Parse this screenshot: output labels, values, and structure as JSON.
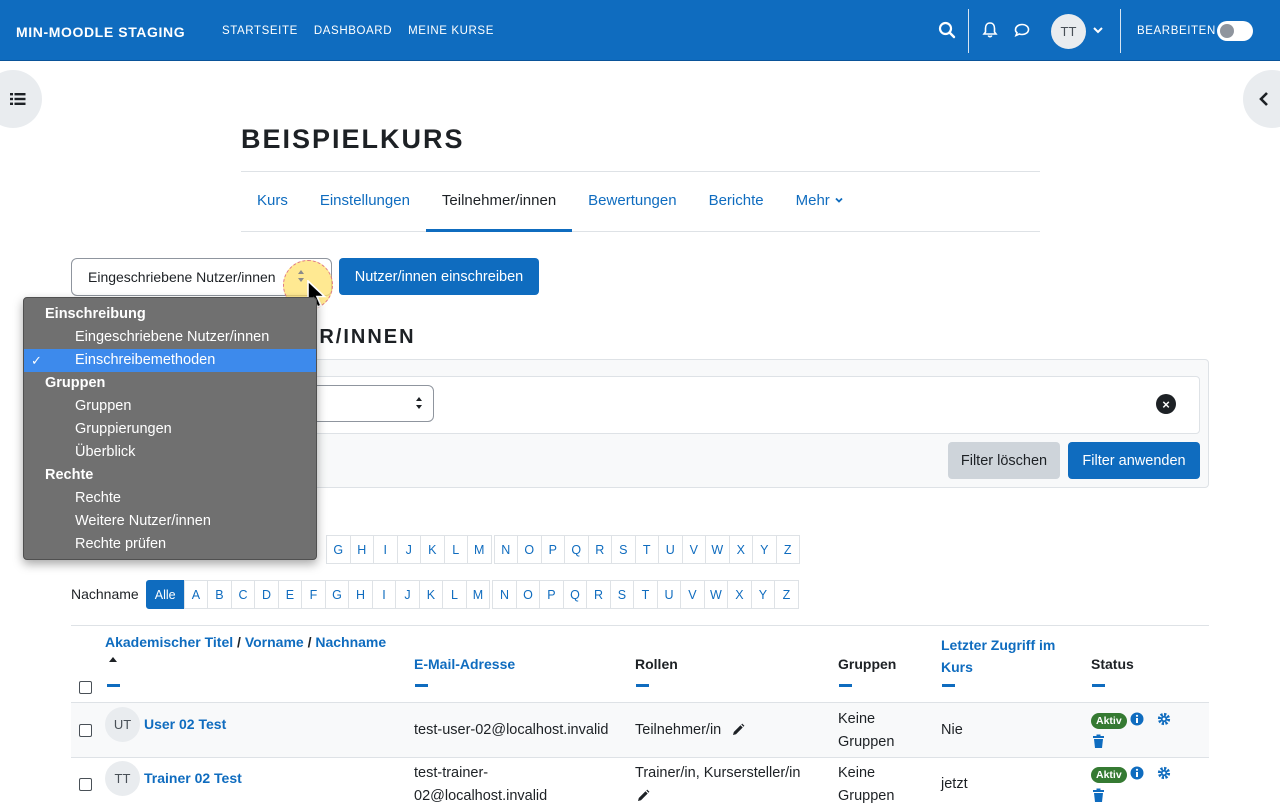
{
  "navbar": {
    "brand": "MIN-MOODLE STAGING",
    "links": [
      "STARTSEITE",
      "DASHBOARD",
      "MEINE KURSE"
    ],
    "user_initials": "TT",
    "edit_label": "BEARBEITEN"
  },
  "course": {
    "title": "BEISPIELKURS",
    "tabs": [
      {
        "label": "Kurs",
        "active": false
      },
      {
        "label": "Einstellungen",
        "active": false
      },
      {
        "label": "Teilnehmer/innen",
        "active": true
      },
      {
        "label": "Bewertungen",
        "active": false
      },
      {
        "label": "Berichte",
        "active": false
      },
      {
        "label": "Mehr",
        "active": false
      }
    ]
  },
  "toolbar": {
    "select_value": "Eingeschriebene Nutzer/innen",
    "enrol_button": "Nutzer/innen einschreiben"
  },
  "section": {
    "heading_visible_part": "ER/INNEN"
  },
  "filters": {
    "clear_button": "Filter löschen",
    "apply_button": "Filter anwenden"
  },
  "alpha": {
    "firstname_letters_visible": [
      "G",
      "H",
      "I",
      "J",
      "K",
      "L",
      "M",
      "N",
      "O",
      "P",
      "Q",
      "R",
      "S",
      "T",
      "U",
      "V",
      "W",
      "X",
      "Y",
      "Z"
    ],
    "lastname_label": "Nachname",
    "lastname_letters": [
      "Alle",
      "A",
      "B",
      "C",
      "D",
      "E",
      "F",
      "G",
      "H",
      "I",
      "J",
      "K",
      "L",
      "M",
      "N",
      "O",
      "P",
      "Q",
      "R",
      "S",
      "T",
      "U",
      "V",
      "W",
      "X",
      "Y",
      "Z"
    ]
  },
  "table": {
    "headers": {
      "name_part1": "Akademischer Titel",
      "name_part2": "Vorname",
      "name_part3": "Nachname",
      "separator": "/",
      "email": "E-Mail-Adresse",
      "roles": "Rollen",
      "groups": "Gruppen",
      "last_access": "Letzter Zugriff im Kurs",
      "status": "Status"
    },
    "rows": [
      {
        "initials": "UT",
        "name": "User 02 Test",
        "email": "test-user-02@localhost.invalid",
        "roles": "Teilnehmer/in",
        "groups": "Keine Gruppen",
        "last_access": "Nie",
        "status": "Aktiv"
      },
      {
        "initials": "TT",
        "name": "Trainer 02 Test",
        "email_line1": "test-trainer-",
        "email_line2": "02@localhost.invalid",
        "roles": "Trainer/in, Kursersteller/in",
        "groups": "Keine Gruppen",
        "last_access": "jetzt",
        "status": "Aktiv"
      }
    ]
  },
  "dropdown": {
    "groups": [
      {
        "label": "Einschreibung",
        "items": [
          {
            "label": "Eingeschriebene Nutzer/innen",
            "selected": false
          },
          {
            "label": "Einschreibemethoden",
            "selected": true
          }
        ]
      },
      {
        "label": "Gruppen",
        "items": [
          {
            "label": "Gruppen",
            "selected": false
          },
          {
            "label": "Gruppierungen",
            "selected": false
          },
          {
            "label": "Überblick",
            "selected": false
          }
        ]
      },
      {
        "label": "Rechte",
        "items": [
          {
            "label": "Rechte",
            "selected": false
          },
          {
            "label": "Weitere Nutzer/innen",
            "selected": false
          },
          {
            "label": "Rechte prüfen",
            "selected": false
          }
        ]
      }
    ],
    "check_mark": "✓"
  },
  "colors": {
    "primary": "#0f6cbf",
    "badge_active": "#357a32",
    "dropdown_highlight": "#3d8aec"
  }
}
